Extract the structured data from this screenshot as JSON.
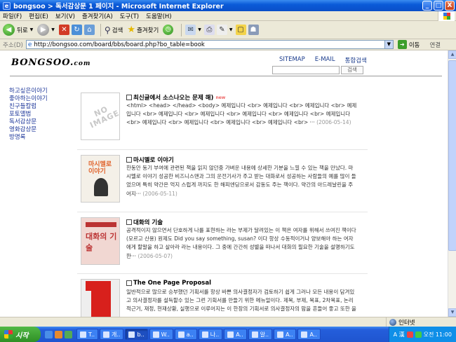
{
  "window": {
    "title": "bongsoo > 독서감상문 1 페이지 - Microsoft Internet Explorer",
    "controls": [
      "_",
      "□",
      "X"
    ]
  },
  "menu": [
    "파일(F)",
    "편집(E)",
    "보기(V)",
    "즐겨찾기(A)",
    "도구(T)",
    "도움말(H)"
  ],
  "toolbar": {
    "back": "뒤로",
    "search": "검색",
    "favorites": "즐겨찾기"
  },
  "address": {
    "label": "주소(D)",
    "url": "http://bongsoo.com/board/bbs/board.php?bo_table=book",
    "go": "이동",
    "links": "연결"
  },
  "site": {
    "logo": "BONGSOO.",
    "logo_suffix": "com",
    "nav": [
      "SITEMAP",
      "E-MAIL",
      "통합검색"
    ],
    "search_button": "검색"
  },
  "sidebar": [
    "하고싶은이야기",
    "좋아하는이야기",
    "친구들칼럼",
    "포토앨범",
    "독서감상문",
    "영화감상문",
    "방명록"
  ],
  "posts": [
    {
      "title": "최신글에서 소스나오는 문제 해)",
      "thumb": "NO IMAGE",
      "body": "<html> <head> </head> <body> 예제입니다 <br> 예제입니다 <br> 예제입니다 <br> 예제입니다 <br> 예제입니다 <br> 예제입니다 <br> 예제입니다 <br> 예제입니다 <br> 예제입니다 <br> 예제입니다 <br> 예제입니다 <br> 예제입니다 <br> 예제입니다 <br> ···",
      "date": "(2006-05-14)"
    },
    {
      "title": "마시멜로 이야기",
      "thumb": "마시멜로 이야기",
      "body": "한동안 동기 부여에 관련된 책을 읽지 않던중 가벼운 내용에 상세한 기분을 느낄 수 있는 책을 만났다. 마시멜로 이야기 성공한 비즈니스맨과 그의 운전기사가 주고 받는 대화로서 성공하는 사람들의 예를 많이 들었으며 특히 약간은 억지 스럽게 까지도 한 해피엔딩으로서 감동도 주는 책이다. 약간의 아드레날린을 주어지···",
      "date": "(2006-05-11)"
    },
    {
      "title": "대화의 기술",
      "thumb": "대화의 기술",
      "body": "공격적이지 않으면서 단호하게 나를 표현하는 라는 부제가 달려있는 이 책은 여자를 위해서 쓰여진 책이다(모르고 산용) 원제도 Did you say something, susan? 이다 항상 수동적이거나 양보해야 하는 여자에게 할말을 하고 살아라 라는 내용이다. 그 중에 간간히 성별을 떠나서 대화의 필요한 기술을 설명하기도 한···",
      "date": "(2006-05-07)"
    },
    {
      "title": "The One Page Proposal",
      "thumb": "1",
      "body": "일반적으로 많으로 승부했던 기획서를 항상 바쁜 의사결정자가 검토하기 쉽게 그러나 모든 내용이 담겨있고 의사결정자를 설득할수 있는 그런 기획서를 만들기 위한 메뉴얼이다. 제목, 부제, 목표, 2차목표, 논리적근거, 재정, 현재상황, 실행으로 이루어지는 이 한장의 기획서로 의사결정자의 맘을 흔들어 좋고 또한 을···",
      "date": ""
    }
  ],
  "status": {
    "main": "",
    "zone": "인터넷"
  },
  "taskbar": {
    "start": "시작",
    "tasks": [
      "T..",
      "개..",
      "b..",
      "W..",
      "a..",
      "나..",
      "A..",
      "알..",
      "A..",
      "A.."
    ],
    "tray_lang": "A 漢",
    "clock": "오전 11:00"
  }
}
